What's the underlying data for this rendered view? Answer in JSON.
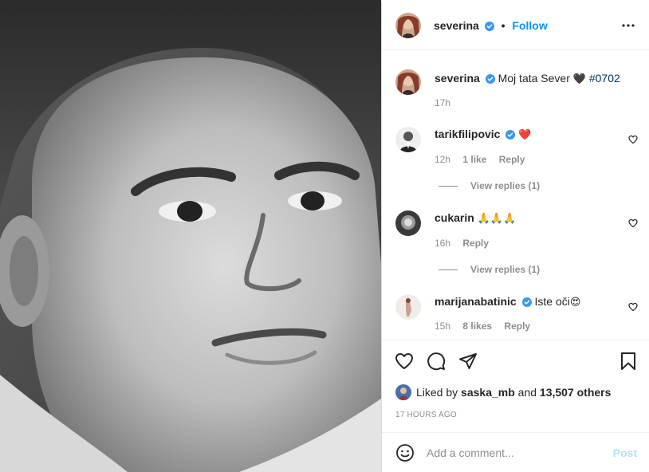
{
  "post": {
    "image_alt": "Black and white portrait photograph",
    "author": {
      "username": "severina",
      "verified": true,
      "follow_label": "Follow",
      "separator": "•"
    },
    "caption": {
      "username": "severina",
      "text": "Moj tata Sever",
      "emoji": "🖤",
      "hashtag": "#0702",
      "time": "17h"
    },
    "comments": [
      {
        "username": "tarikfilipovic",
        "verified": true,
        "text": "❤️",
        "time": "12h",
        "likes": "1 like",
        "reply_label": "Reply",
        "view_replies": "View replies (1)"
      },
      {
        "username": "cukarin",
        "verified": false,
        "text": "🙏🙏🙏",
        "time": "16h",
        "likes": "",
        "reply_label": "Reply",
        "view_replies": "View replies (1)"
      },
      {
        "username": "marijanabatinic",
        "verified": true,
        "text": "Iste oči",
        "emoji": "😍",
        "time": "15h",
        "likes": "8 likes",
        "reply_label": "Reply"
      }
    ],
    "liked_by": {
      "prefix": "Liked by",
      "user": "saska_mb",
      "connector": "and",
      "others": "13,507 others"
    },
    "time_ago": "17 HOURS AGO",
    "add_comment": {
      "placeholder": "Add a comment...",
      "post_label": "Post"
    }
  },
  "colors": {
    "accent_blue": "#0095f6",
    "verified_blue": "#3897f0",
    "hashtag": "#00376b",
    "muted": "#8e8e8e",
    "post_disabled": "#b2dffc"
  }
}
